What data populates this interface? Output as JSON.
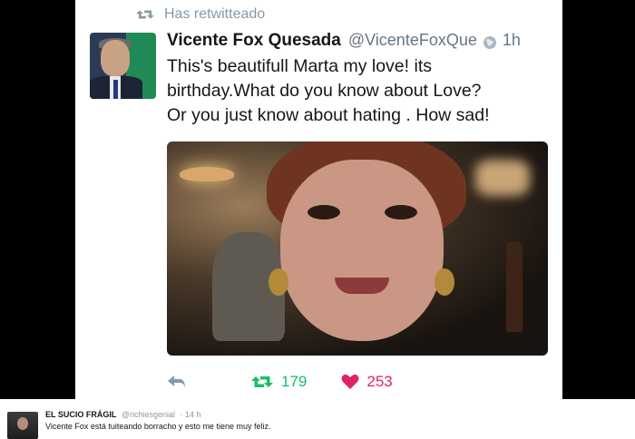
{
  "retweet_banner": {
    "icon": "retweet-icon",
    "label": "Has retwitteado"
  },
  "tweet": {
    "author_name": "Vicente Fox Quesada",
    "author_handle": "@VicenteFoxQue",
    "globe_icon": "globe-icon",
    "time": "1h",
    "text": "This's  beautifull Marta my love! its\nbirthday.What do you know about Love?\nOr you just know about hating . How sad!",
    "actions": {
      "reply_icon": "reply-icon",
      "retweet_count": "179",
      "like_count": "253"
    }
  },
  "reply_tweet": {
    "author_name": "EL SUCIO FRÁGIL",
    "author_handle": "@richiesgenial",
    "time": "· 14 h",
    "text": "Vicente Fox está tuiteando borracho y esto me tiene muy feliz."
  },
  "colors": {
    "retweet_green": "#17bf63",
    "like_red": "#e0245e",
    "muted_gray": "#8899a6"
  }
}
